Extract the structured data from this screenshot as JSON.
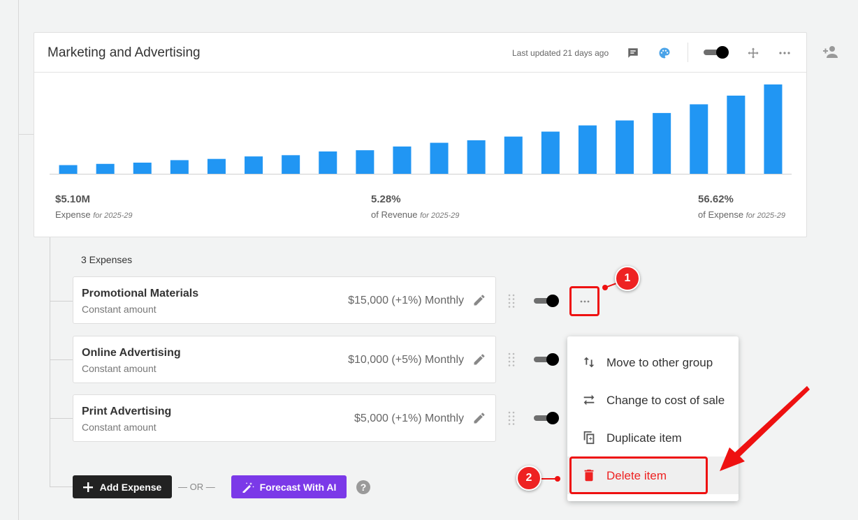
{
  "card": {
    "title": "Marketing and Advertising",
    "last_updated": "Last updated 21 days ago",
    "icons": [
      "comment-icon",
      "palette-icon",
      "toggle",
      "move-icon",
      "more-icon"
    ]
  },
  "chart_data": {
    "type": "bar",
    "title": "",
    "xlabel": "",
    "ylabel": "",
    "color": "#2196f3",
    "values": [
      7,
      8,
      9,
      11,
      12,
      14,
      15,
      18,
      19,
      22,
      25,
      27,
      30,
      34,
      39,
      43,
      49,
      56,
      63,
      72
    ]
  },
  "stats": [
    {
      "value": "$5.10M",
      "label": "Expense",
      "period": "for 2025-29"
    },
    {
      "value": "5.28%",
      "label": "of Revenue",
      "period": "for 2025-29"
    },
    {
      "value": "56.62%",
      "label": "of Expense",
      "period": "for 2025-29"
    }
  ],
  "expenses": {
    "count_label": "3 Expenses",
    "items": [
      {
        "name": "Promotional Materials",
        "type": "Constant amount",
        "amount": "$15,000 (+1%) Monthly"
      },
      {
        "name": "Online Advertising",
        "type": "Constant amount",
        "amount": "$10,000 (+5%) Monthly"
      },
      {
        "name": "Print Advertising",
        "type": "Constant amount",
        "amount": "$5,000 (+1%) Monthly"
      }
    ]
  },
  "menu": {
    "items": [
      {
        "label": "Move to other group",
        "icon": "swap-vertical-icon"
      },
      {
        "label": "Change to cost of sale",
        "icon": "swap-horizontal-icon"
      },
      {
        "label": "Duplicate item",
        "icon": "duplicate-icon"
      },
      {
        "label": "Delete item",
        "icon": "trash-icon"
      }
    ]
  },
  "footer": {
    "add_label": "Add Expense",
    "or_label": "— OR —",
    "ai_label": "Forecast With AI",
    "help": "?"
  },
  "annotations": {
    "step1": "1",
    "step2": "2",
    "accent": "#e11d1d"
  },
  "colors": {
    "accent_blue": "#2196f3",
    "ai_purple": "#7b39e8",
    "danger": "#e22222"
  }
}
